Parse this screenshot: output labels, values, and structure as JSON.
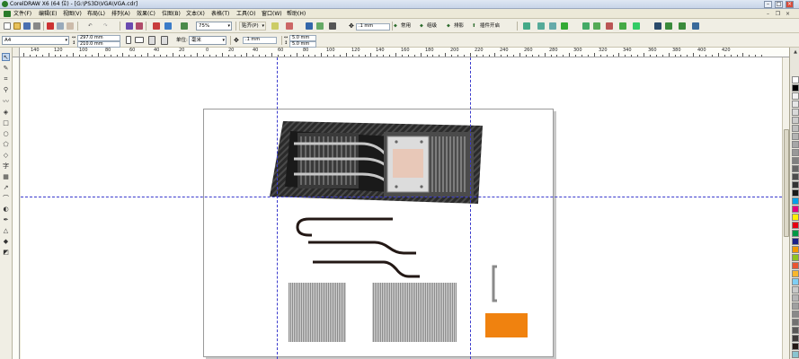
{
  "titlebar": {
    "title": "CorelDRAW X6 (64 位) - [G:\\PS3D\\VGA\\VGA.cdr]"
  },
  "menubar": {
    "items": [
      {
        "label": "文件(F)"
      },
      {
        "label": "编辑(E)"
      },
      {
        "label": "视图(V)"
      },
      {
        "label": "布局(L)"
      },
      {
        "label": "排列(A)"
      },
      {
        "label": "效果(C)"
      },
      {
        "label": "位图(B)"
      },
      {
        "label": "文本(X)"
      },
      {
        "label": "表格(T)"
      },
      {
        "label": "工具(O)"
      },
      {
        "label": "窗口(W)"
      },
      {
        "label": "帮助(H)"
      }
    ]
  },
  "toolbar": {
    "zoom": "75%",
    "snap_label": "贴齐(P)",
    "nudge": ".1 mm",
    "apps": [
      {
        "label": "常用"
      },
      {
        "label": "组级"
      },
      {
        "label": "排影"
      },
      {
        "label": "插件开启"
      }
    ]
  },
  "propertybar": {
    "page_size": "A4",
    "width": "297.0 mm",
    "height": "210.0 mm",
    "units_label": "单位:",
    "units": "毫米",
    "nudge": ".1 mm",
    "dup_x": "5.0 mm",
    "dup_y": "5.0 mm"
  },
  "ruler": {
    "labels": [
      "140",
      "120",
      "100",
      "80",
      "60",
      "40",
      "20",
      "0",
      "20",
      "40",
      "60",
      "80",
      "100",
      "120",
      "140",
      "160",
      "180",
      "200",
      "220",
      "240",
      "260",
      "280",
      "300",
      "320",
      "340",
      "360",
      "380",
      "400",
      "420"
    ]
  },
  "palette": {
    "colors": [
      "#ffffff",
      "#000000",
      "#f2f2f2",
      "#e6e6e6",
      "#d9d9d9",
      "#cccccc",
      "#bfbfbf",
      "#b3b3b3",
      "#a6a6a6",
      "#999999",
      "#808080",
      "#666666",
      "#4d4d4d",
      "#333333",
      "#1a1a1a",
      "#00a0e9",
      "#e4007f",
      "#fff100",
      "#e60012",
      "#009944",
      "#1d2088",
      "#f39800",
      "#8fc31f",
      "#ea5532",
      "#f8b62d",
      "#7ecef4",
      "#c9caca",
      "#b5b5b6",
      "#9fa0a0",
      "#898989",
      "#727171",
      "#595757",
      "#3e3a39",
      "#231815",
      "#8ac4d0",
      "#2ca6c0"
    ]
  },
  "colors": {
    "guide": "#3a3acd",
    "orange_rect": "#f0820f",
    "heatpipe": "#231815",
    "fin_gray": "#a8a8a8"
  }
}
